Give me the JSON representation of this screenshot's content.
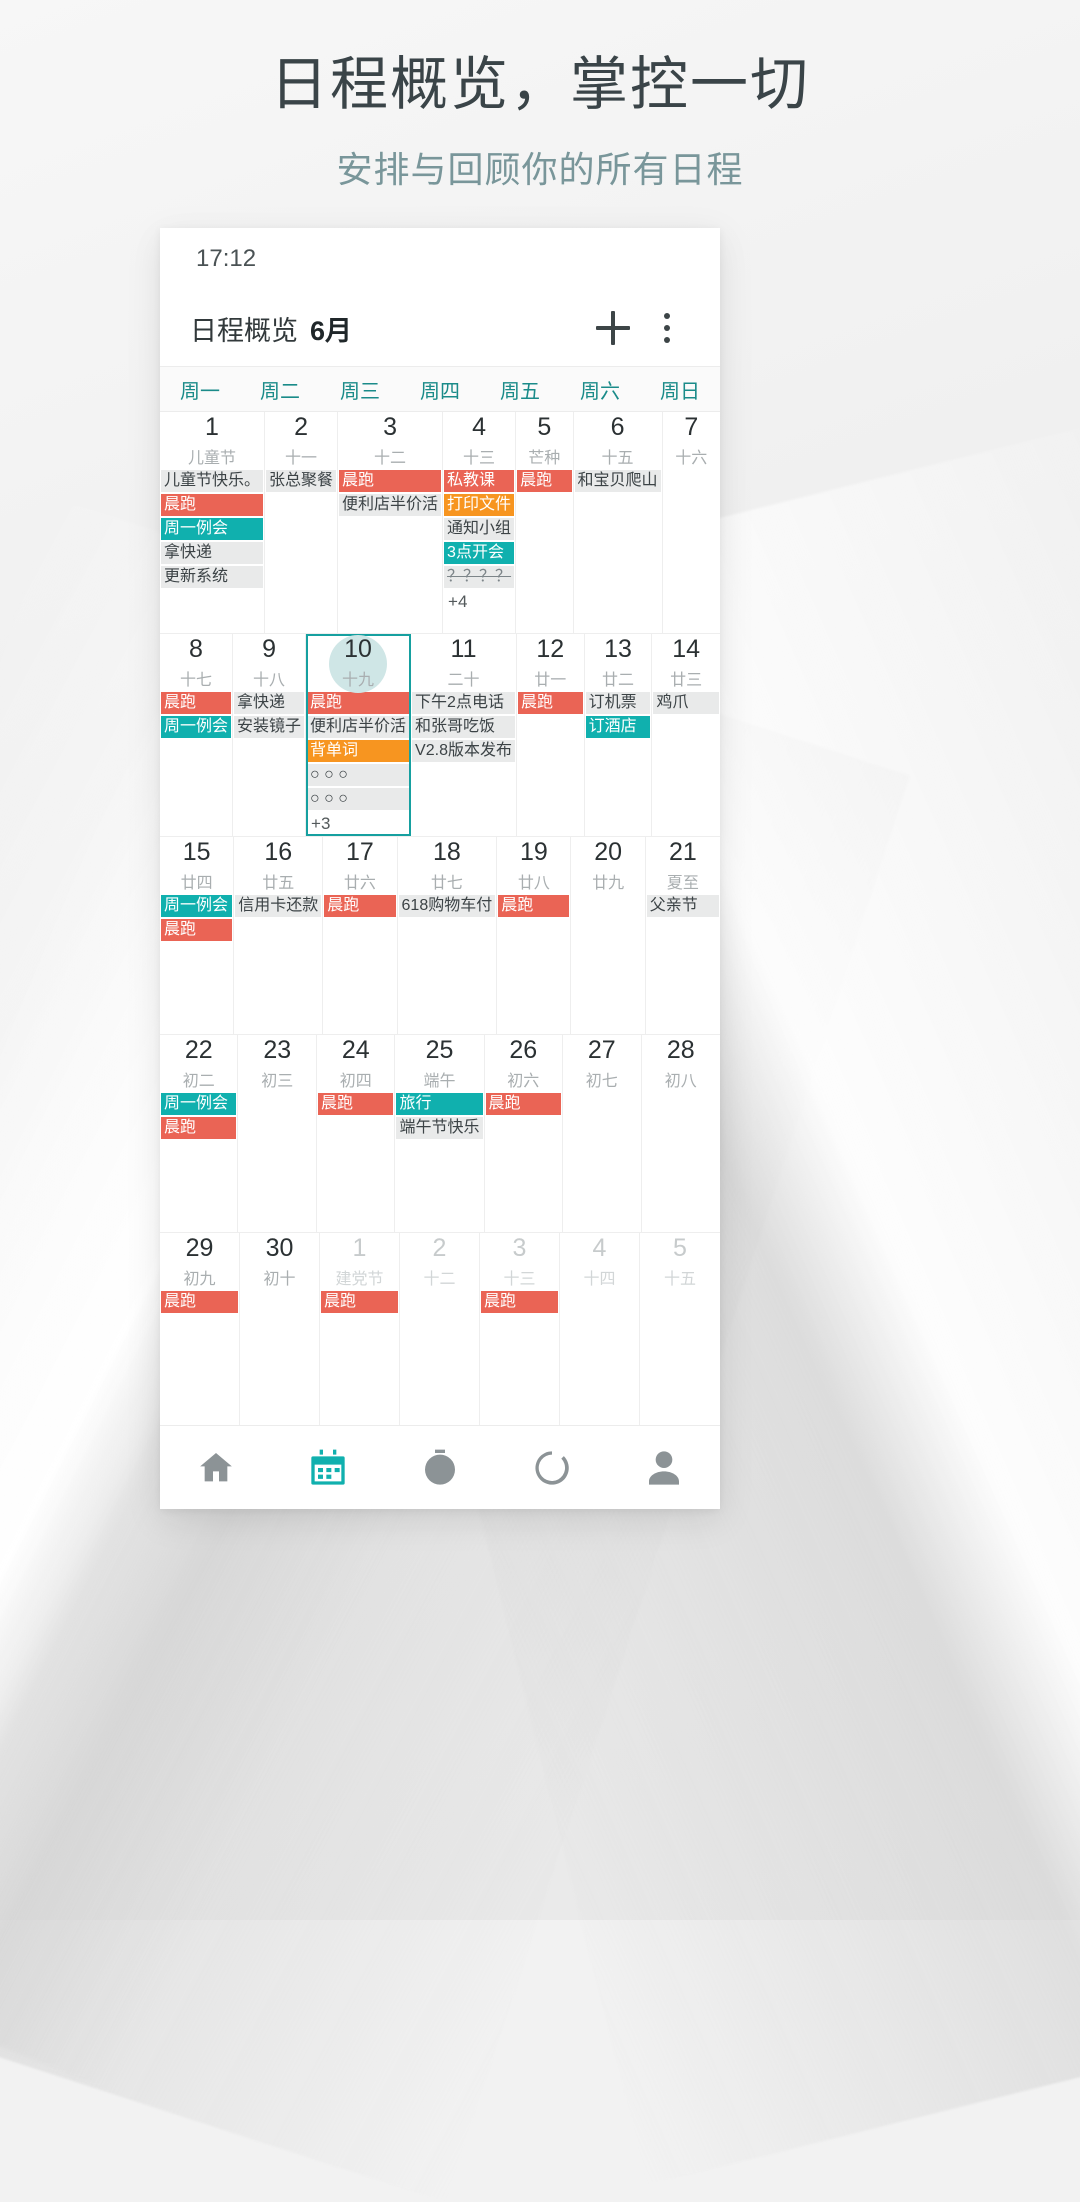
{
  "promo": {
    "title": "日程概览，掌控一切",
    "subtitle": "安排与回顾你的所有日程"
  },
  "phone": {
    "status_time": "17:12",
    "appbar": {
      "title": "日程概览",
      "month": "6月",
      "add_icon": "plus-icon",
      "overflow_icon": "more-vertical-icon"
    },
    "weekdays": [
      "周一",
      "周二",
      "周三",
      "周四",
      "周五",
      "周六",
      "周日"
    ],
    "colors": {
      "accent": "#10b0ae",
      "red": "#ea6455",
      "orange": "#f79520",
      "grey_chip": "#e9eaea",
      "selected_circle": "#cfe6e6"
    },
    "bottom_nav": [
      {
        "name": "home-icon",
        "active": false
      },
      {
        "name": "calendar-icon",
        "active": true
      },
      {
        "name": "timer-icon",
        "active": false
      },
      {
        "name": "ring-progress-icon",
        "active": false
      },
      {
        "name": "person-icon",
        "active": false
      }
    ],
    "weeks": [
      [
        {
          "num": "1",
          "lunar": "儿童节",
          "other": false,
          "selected": false,
          "events": [
            {
              "text": "儿童节快乐。",
              "style": "grey"
            },
            {
              "text": "晨跑",
              "style": "red"
            },
            {
              "text": "周一例会",
              "style": "teal"
            },
            {
              "text": "拿快递",
              "style": "grey"
            },
            {
              "text": "更新系统",
              "style": "grey"
            }
          ],
          "more": ""
        },
        {
          "num": "2",
          "lunar": "十一",
          "other": false,
          "selected": false,
          "events": [
            {
              "text": "张总聚餐",
              "style": "grey"
            }
          ],
          "more": ""
        },
        {
          "num": "3",
          "lunar": "十二",
          "other": false,
          "selected": false,
          "events": [
            {
              "text": "晨跑",
              "style": "red"
            },
            {
              "text": "便利店半价活",
              "style": "grey"
            }
          ],
          "more": ""
        },
        {
          "num": "4",
          "lunar": "十三",
          "other": false,
          "selected": false,
          "events": [
            {
              "text": "私教课",
              "style": "red"
            },
            {
              "text": "打印文件",
              "style": "orange"
            },
            {
              "text": "通知小组",
              "style": "grey"
            },
            {
              "text": "3点开会",
              "style": "teal"
            },
            {
              "text": "？？？？",
              "style": "done"
            }
          ],
          "more": "+4"
        },
        {
          "num": "5",
          "lunar": "芒种",
          "other": false,
          "selected": false,
          "events": [
            {
              "text": "晨跑",
              "style": "red"
            }
          ],
          "more": ""
        },
        {
          "num": "6",
          "lunar": "十五",
          "other": false,
          "selected": false,
          "events": [
            {
              "text": "和宝贝爬山",
              "style": "grey"
            }
          ],
          "more": ""
        },
        {
          "num": "7",
          "lunar": "十六",
          "other": false,
          "selected": false,
          "events": [],
          "more": ""
        }
      ],
      [
        {
          "num": "8",
          "lunar": "十七",
          "other": false,
          "selected": false,
          "events": [
            {
              "text": "晨跑",
              "style": "red"
            },
            {
              "text": "周一例会",
              "style": "teal"
            }
          ],
          "more": ""
        },
        {
          "num": "9",
          "lunar": "十八",
          "other": false,
          "selected": false,
          "events": [
            {
              "text": "拿快递",
              "style": "grey"
            },
            {
              "text": "安装镜子",
              "style": "grey"
            }
          ],
          "more": ""
        },
        {
          "num": "10",
          "lunar": "十九",
          "other": false,
          "selected": true,
          "events": [
            {
              "text": "晨跑",
              "style": "red"
            },
            {
              "text": "便利店半价活",
              "style": "grey"
            },
            {
              "text": "背单词",
              "style": "orange"
            },
            {
              "text": "○ ○ ○",
              "style": "grey"
            },
            {
              "text": "○ ○ ○",
              "style": "grey"
            }
          ],
          "more": "+3"
        },
        {
          "num": "11",
          "lunar": "二十",
          "other": false,
          "selected": false,
          "events": [
            {
              "text": "下午2点电话",
              "style": "grey"
            },
            {
              "text": "和张哥吃饭",
              "style": "grey"
            },
            {
              "text": "V2.8版本发布",
              "style": "grey"
            }
          ],
          "more": ""
        },
        {
          "num": "12",
          "lunar": "廿一",
          "other": false,
          "selected": false,
          "events": [
            {
              "text": "晨跑",
              "style": "red"
            }
          ],
          "more": ""
        },
        {
          "num": "13",
          "lunar": "廿二",
          "other": false,
          "selected": false,
          "events": [
            {
              "text": "订机票",
              "style": "grey"
            },
            {
              "text": "订酒店",
              "style": "teal"
            }
          ],
          "more": ""
        },
        {
          "num": "14",
          "lunar": "廿三",
          "other": false,
          "selected": false,
          "events": [
            {
              "text": "鸡爪",
              "style": "grey"
            }
          ],
          "more": ""
        }
      ],
      [
        {
          "num": "15",
          "lunar": "廿四",
          "other": false,
          "selected": false,
          "events": [
            {
              "text": "周一例会",
              "style": "teal"
            },
            {
              "text": "晨跑",
              "style": "red"
            }
          ],
          "more": ""
        },
        {
          "num": "16",
          "lunar": "廿五",
          "other": false,
          "selected": false,
          "events": [
            {
              "text": "信用卡还款",
              "style": "grey"
            }
          ],
          "more": ""
        },
        {
          "num": "17",
          "lunar": "廿六",
          "other": false,
          "selected": false,
          "events": [
            {
              "text": "晨跑",
              "style": "red"
            }
          ],
          "more": ""
        },
        {
          "num": "18",
          "lunar": "廿七",
          "other": false,
          "selected": false,
          "events": [
            {
              "text": "618购物车付",
              "style": "grey"
            }
          ],
          "more": ""
        },
        {
          "num": "19",
          "lunar": "廿八",
          "other": false,
          "selected": false,
          "events": [
            {
              "text": "晨跑",
              "style": "red"
            }
          ],
          "more": ""
        },
        {
          "num": "20",
          "lunar": "廿九",
          "other": false,
          "selected": false,
          "events": [],
          "more": ""
        },
        {
          "num": "21",
          "lunar": "夏至",
          "other": false,
          "selected": false,
          "events": [
            {
              "text": "父亲节",
              "style": "grey"
            }
          ],
          "more": ""
        }
      ],
      [
        {
          "num": "22",
          "lunar": "初二",
          "other": false,
          "selected": false,
          "events": [
            {
              "text": "周一例会",
              "style": "teal"
            },
            {
              "text": "晨跑",
              "style": "red"
            }
          ],
          "more": ""
        },
        {
          "num": "23",
          "lunar": "初三",
          "other": false,
          "selected": false,
          "events": [],
          "more": ""
        },
        {
          "num": "24",
          "lunar": "初四",
          "other": false,
          "selected": false,
          "events": [
            {
              "text": "晨跑",
              "style": "red"
            }
          ],
          "more": ""
        },
        {
          "num": "25",
          "lunar": "端午",
          "other": false,
          "selected": false,
          "events": [
            {
              "text": "旅行",
              "style": "teal"
            },
            {
              "text": "端午节快乐",
              "style": "grey"
            }
          ],
          "more": ""
        },
        {
          "num": "26",
          "lunar": "初六",
          "other": false,
          "selected": false,
          "events": [
            {
              "text": "晨跑",
              "style": "red"
            }
          ],
          "more": ""
        },
        {
          "num": "27",
          "lunar": "初七",
          "other": false,
          "selected": false,
          "events": [],
          "more": ""
        },
        {
          "num": "28",
          "lunar": "初八",
          "other": false,
          "selected": false,
          "events": [],
          "more": ""
        }
      ],
      [
        {
          "num": "29",
          "lunar": "初九",
          "other": false,
          "selected": false,
          "events": [
            {
              "text": "晨跑",
              "style": "red"
            }
          ],
          "more": ""
        },
        {
          "num": "30",
          "lunar": "初十",
          "other": false,
          "selected": false,
          "events": [],
          "more": ""
        },
        {
          "num": "1",
          "lunar": "建党节",
          "other": true,
          "selected": false,
          "events": [
            {
              "text": "晨跑",
              "style": "red"
            }
          ],
          "more": ""
        },
        {
          "num": "2",
          "lunar": "十二",
          "other": true,
          "selected": false,
          "events": [],
          "more": ""
        },
        {
          "num": "3",
          "lunar": "十三",
          "other": true,
          "selected": false,
          "events": [
            {
              "text": "晨跑",
              "style": "red"
            }
          ],
          "more": ""
        },
        {
          "num": "4",
          "lunar": "十四",
          "other": true,
          "selected": false,
          "events": [],
          "more": ""
        },
        {
          "num": "5",
          "lunar": "十五",
          "other": true,
          "selected": false,
          "events": [],
          "more": ""
        }
      ]
    ]
  }
}
